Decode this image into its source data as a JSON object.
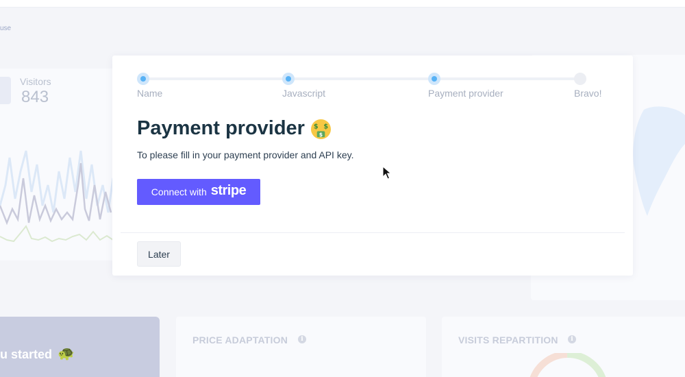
{
  "background": {
    "breadcrumb_fragment": "use",
    "visitors": {
      "label": "Visitors",
      "value": "843"
    },
    "started_fragment": "u started",
    "started_icon": "turtle-icon",
    "price_title": "PRICE ADAPTATION",
    "visits_title": "VISITS REPARTITION",
    "info_icon": "i"
  },
  "modal": {
    "steps": [
      {
        "label": "Name",
        "state": "done"
      },
      {
        "label": "Javascript",
        "state": "done"
      },
      {
        "label": "Payment provider",
        "state": "current"
      },
      {
        "label": "Bravo!",
        "state": "todo"
      }
    ],
    "title": "Payment provider",
    "title_icon": "money-mouth-face-icon",
    "description": "To please fill in your payment provider and API key.",
    "connect_label": "Connect with",
    "connect_brand": "stripe",
    "later_label": "Later",
    "colors": {
      "stripe": "#635bff",
      "step_done": "#58b2f5",
      "title": "#1b3443"
    }
  }
}
